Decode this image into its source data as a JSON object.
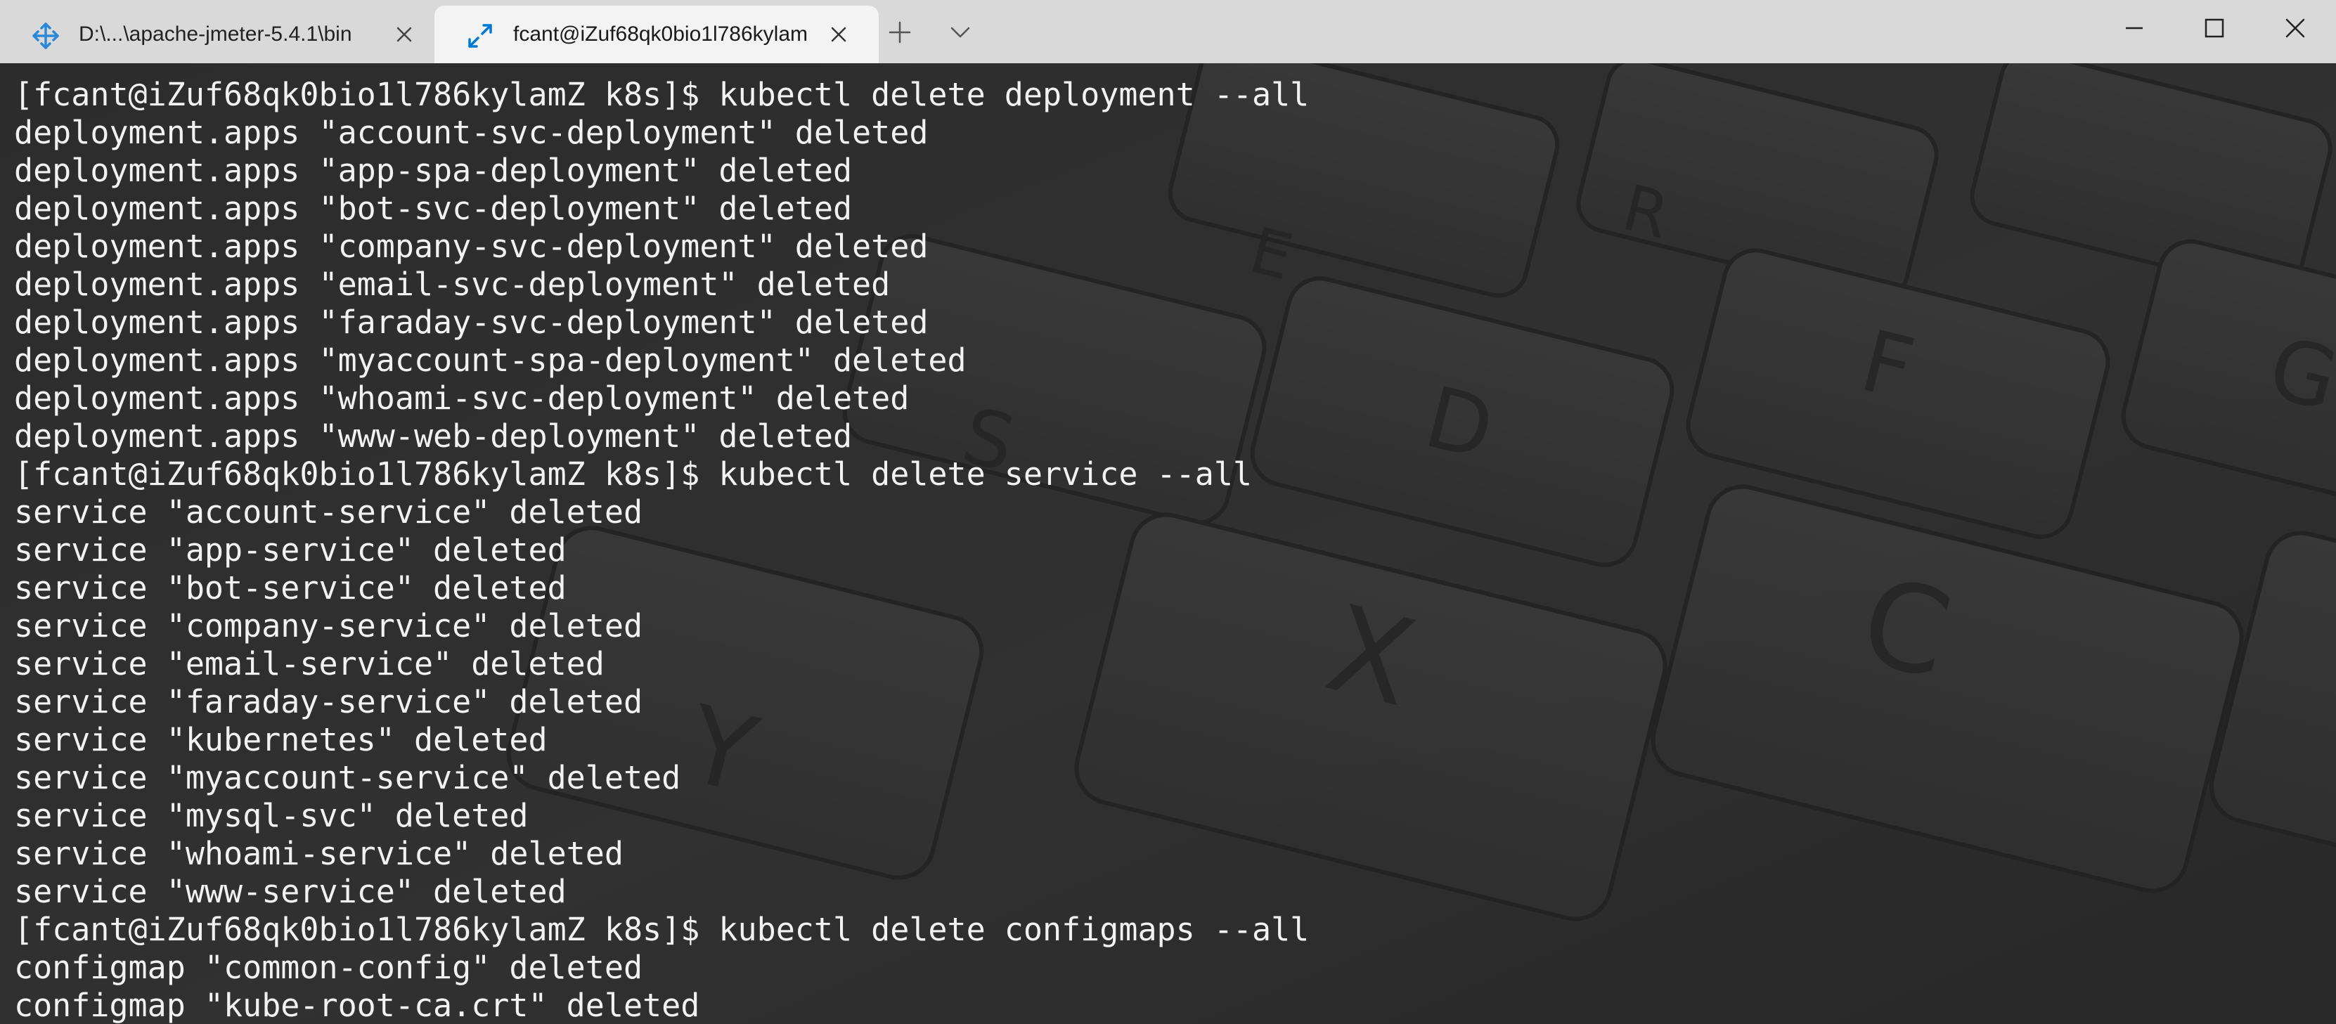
{
  "tabs": [
    {
      "title": "D:\\...\\apache-jmeter-5.4.1\\bin",
      "active": false,
      "icon": "move-arrows-icon"
    },
    {
      "title": "fcant@iZuf68qk0bio1l786kylam",
      "active": true,
      "icon": "ssh-arrows-icon"
    }
  ],
  "colors": {
    "accent": "#0078d4",
    "titlebar": "#d9d9d9",
    "active_tab": "#f3f3f3",
    "terminal_text": "#f2f2f2"
  },
  "terminal": {
    "lines": [
      "[fcant@iZuf68qk0bio1l786kylamZ k8s]$ kubectl delete deployment --all",
      "deployment.apps \"account-svc-deployment\" deleted",
      "deployment.apps \"app-spa-deployment\" deleted",
      "deployment.apps \"bot-svc-deployment\" deleted",
      "deployment.apps \"company-svc-deployment\" deleted",
      "deployment.apps \"email-svc-deployment\" deleted",
      "deployment.apps \"faraday-svc-deployment\" deleted",
      "deployment.apps \"myaccount-spa-deployment\" deleted",
      "deployment.apps \"whoami-svc-deployment\" deleted",
      "deployment.apps \"www-web-deployment\" deleted",
      "[fcant@iZuf68qk0bio1l786kylamZ k8s]$ kubectl delete service --all",
      "service \"account-service\" deleted",
      "service \"app-service\" deleted",
      "service \"bot-service\" deleted",
      "service \"company-service\" deleted",
      "service \"email-service\" deleted",
      "service \"faraday-service\" deleted",
      "service \"kubernetes\" deleted",
      "service \"myaccount-service\" deleted",
      "service \"mysql-svc\" deleted",
      "service \"whoami-service\" deleted",
      "service \"www-service\" deleted",
      "[fcant@iZuf68qk0bio1l786kylamZ k8s]$ kubectl delete configmaps --all",
      "configmap \"common-config\" deleted",
      "configmap \"kube-root-ca.crt\" deleted"
    ]
  },
  "background_key_letters": [
    "R",
    "E",
    "S",
    "D",
    "F",
    "G",
    "X",
    "C",
    "Y"
  ]
}
